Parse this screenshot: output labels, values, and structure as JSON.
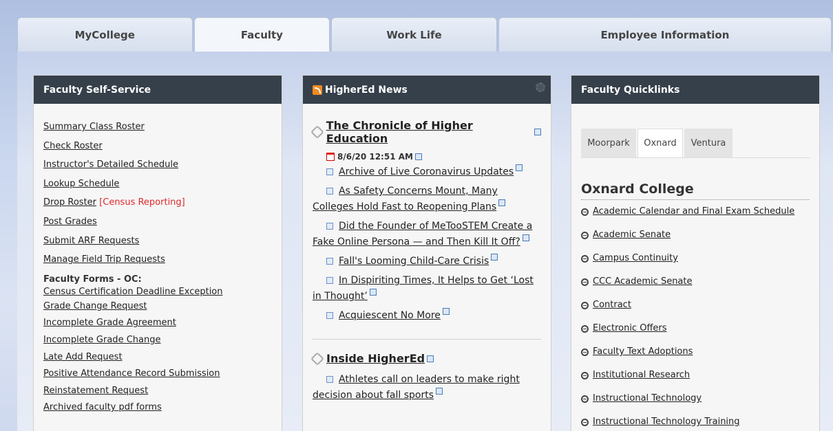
{
  "top_tabs": [
    "MyCollege",
    "Faculty",
    "Work Life",
    "Employee Information"
  ],
  "self_service": {
    "title": "Faculty Self-Service",
    "links": [
      "Summary Class Roster",
      "Check Roster",
      "Instructor's Detailed Schedule",
      "Lookup Schedule"
    ],
    "drop_roster": "Drop Roster",
    "drop_roster_note": "[Census Reporting]",
    "links2": [
      "Post Grades",
      "Submit ARF Requests",
      "Manage Field Trip Requests"
    ],
    "forms_heading": "Faculty Forms - OC:",
    "forms": [
      "Census Certification Deadline Exception",
      "Grade Change Request",
      "Incomplete Grade Agreement",
      "Incomplete Grade Change",
      "Late Add Request",
      "Positive Attendance Record Submission",
      "Reinstatement Request",
      "Archived faculty pdf forms"
    ]
  },
  "news": {
    "title": "HigherEd News",
    "feed1": {
      "title": "The Chronicle of Higher Education",
      "date": "8/6/20 12:51 AM",
      "items": [
        "Archive of Live Coronavirus Updates",
        "As Safety Concerns Mount, Many Colleges Hold Fast to Reopening Plans",
        "Did the Founder of MeTooSTEM Create a Fake Online Persona — and Then Kill It Off?",
        "Fall's Looming Child-Care Crisis",
        "In Dispiriting Times, It Helps to Get ‘Lost in Thought’",
        "Acquiescent No More"
      ]
    },
    "feed2": {
      "title": "Inside HigherEd",
      "items": [
        "Athletes call on leaders to make right decision about fall sports"
      ]
    }
  },
  "quicklinks": {
    "title": "Faculty Quicklinks",
    "tabs": [
      "Moorpark",
      "Oxnard",
      "Ventura"
    ],
    "college": "Oxnard College",
    "items": [
      "Academic Calendar and Final Exam Schedule",
      "Academic Senate",
      "Campus Continuity",
      "CCC Academic Senate",
      "Contract",
      "Electronic Offers",
      "Faculty Text Adoptions",
      "Institutional Research",
      "Instructional Technology",
      "Instructional Technology Training"
    ]
  }
}
